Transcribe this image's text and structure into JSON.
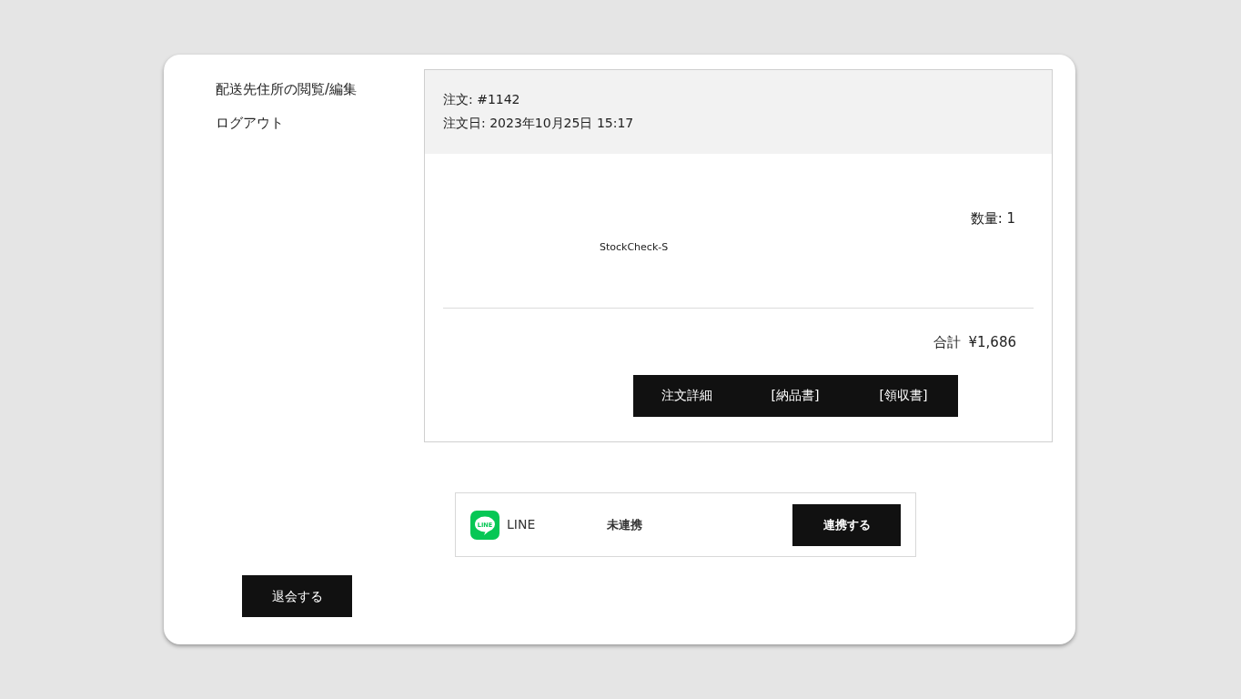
{
  "sidebar": {
    "items": [
      "配送先住所の閲覧/編集",
      "ログアウト"
    ]
  },
  "order": {
    "number": "注文: #1142",
    "date": "注文日: 2023年10月25日 15:17",
    "product": "StockCheck-S",
    "quantity": "数量: 1",
    "total_label": "合計",
    "total": "¥1,686",
    "buttons": [
      "注文詳細",
      "[納品書]",
      "[領収書]"
    ]
  },
  "line_link": {
    "logo_text": "LINE",
    "service": "LINE",
    "status": "未連携",
    "button": "連携する"
  },
  "withdraw_button": "退会する"
}
